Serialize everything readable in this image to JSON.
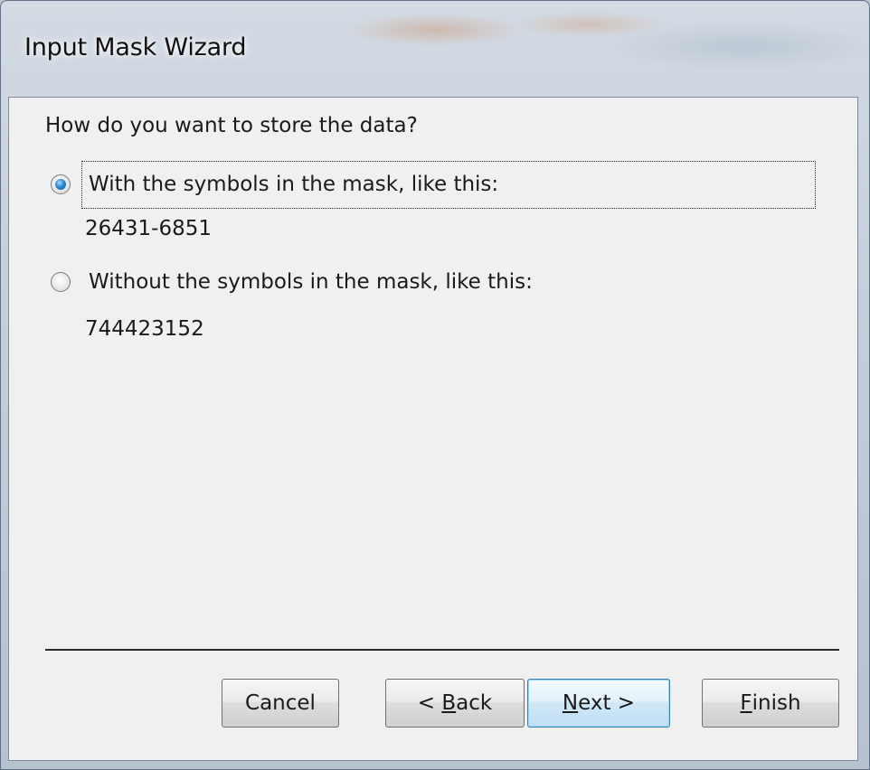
{
  "window": {
    "title": "Input Mask Wizard"
  },
  "prompt": {
    "question": "How do you want to store the data?"
  },
  "options": [
    {
      "label": "With the symbols in the mask, like this:",
      "sample": "26431-6851",
      "checked": true
    },
    {
      "label": "Without the symbols in the mask, like this:",
      "sample": "744423152",
      "checked": false
    }
  ],
  "buttons": {
    "cancel": {
      "label": "Cancel"
    },
    "back": {
      "prefix": "< ",
      "mnemonic": "B",
      "rest": "ack"
    },
    "next": {
      "prefix": "",
      "mnemonic": "N",
      "rest": "ext >"
    },
    "finish": {
      "prefix": "",
      "mnemonic": "F",
      "rest": "inish"
    }
  },
  "colors": {
    "dialog_background": "#f0f0f0",
    "radio_selected": "#1e6fc0",
    "default_button_border": "#3c7fb1"
  }
}
